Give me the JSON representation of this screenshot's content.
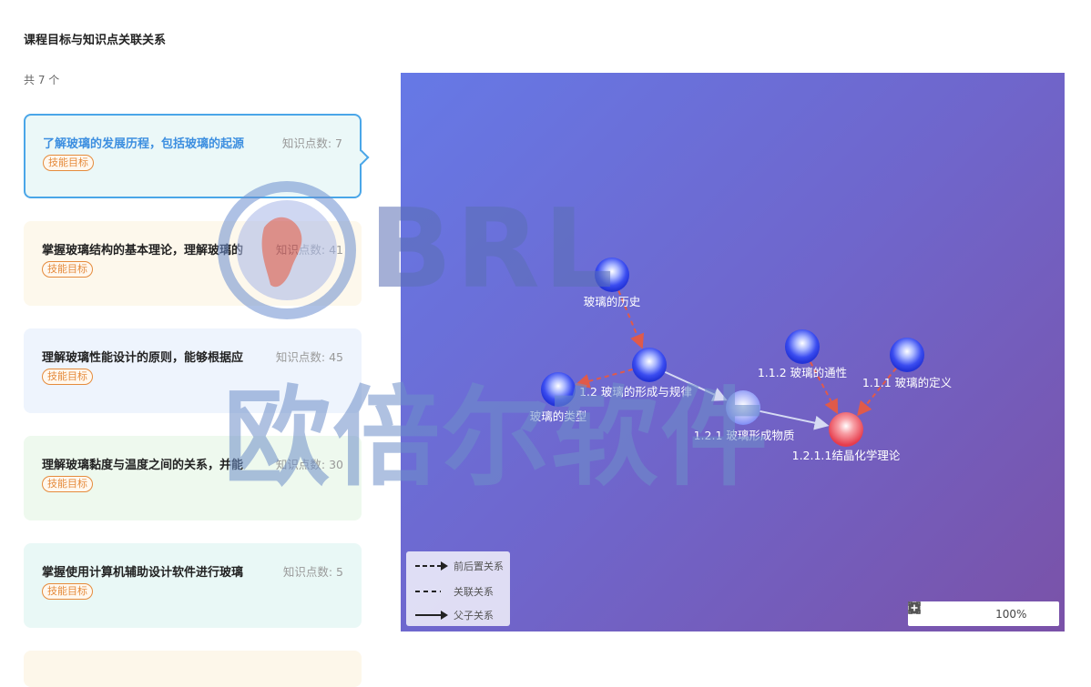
{
  "page_title": "课程目标与知识点关联关系",
  "count_text": "共 7 个",
  "goals": [
    {
      "text": "了解玻璃的发展历程，包括玻璃的起源",
      "kp": "知识点数: 7",
      "tag": "技能目标",
      "bg": "#ebf8f8",
      "selected": true
    },
    {
      "text": "掌握玻璃结构的基本理论，理解玻璃的",
      "kp": "知识点数: 41",
      "tag": "技能目标",
      "bg": "#fdf8ec",
      "selected": false
    },
    {
      "text": "理解玻璃性能设计的原则，能够根据应",
      "kp": "知识点数: 45",
      "tag": "技能目标",
      "bg": "#eef4fd",
      "selected": false
    },
    {
      "text": "理解玻璃黏度与温度之间的关系，并能",
      "kp": "知识点数: 30",
      "tag": "技能目标",
      "bg": "#eef9ee",
      "selected": false
    },
    {
      "text": "掌握使用计算机辅助设计软件进行玻璃",
      "kp": "知识点数: 5",
      "tag": "技能目标",
      "bg": "#e9f8f6",
      "selected": false
    }
  ],
  "graph": {
    "colors": {
      "node": "#3a4cf0",
      "leaf": "#ef4a5a",
      "prereq": "#e05a4a",
      "parent": "#d6dbf3"
    },
    "nodes": [
      {
        "id": "history",
        "label": "玻璃的历史",
        "type": "blue"
      },
      {
        "id": "formation",
        "label": "1.2 玻璃的形成与规律",
        "type": "blue"
      },
      {
        "id": "types",
        "label": "玻璃的类型",
        "type": "blue"
      },
      {
        "id": "substance",
        "label": "1.2.1 玻璃形成物质",
        "type": "light"
      },
      {
        "id": "commonality",
        "label": "1.1.2 玻璃的通性",
        "type": "blue"
      },
      {
        "id": "definition",
        "label": "1.1.1 玻璃的定义",
        "type": "blue"
      },
      {
        "id": "crystal",
        "label": "1.2.1.1结晶化学理论",
        "type": "red"
      }
    ],
    "edges": [
      {
        "from": "history",
        "to": "formation",
        "kind": "prerequisite"
      },
      {
        "from": "formation",
        "to": "types",
        "kind": "prerequisite"
      },
      {
        "from": "formation",
        "to": "substance",
        "kind": "parent"
      },
      {
        "from": "substance",
        "to": "crystal",
        "kind": "parent"
      },
      {
        "from": "commonality",
        "to": "crystal",
        "kind": "prerequisite"
      },
      {
        "from": "definition",
        "to": "crystal",
        "kind": "prerequisite"
      }
    ]
  },
  "legend": {
    "prerequisite": "前后置关系",
    "related": "关联关系",
    "parent": "父子关系"
  },
  "controls": {
    "zoom": "100%"
  },
  "watermark": {
    "brand": "BRL",
    "text": "欧倍尔软件"
  }
}
